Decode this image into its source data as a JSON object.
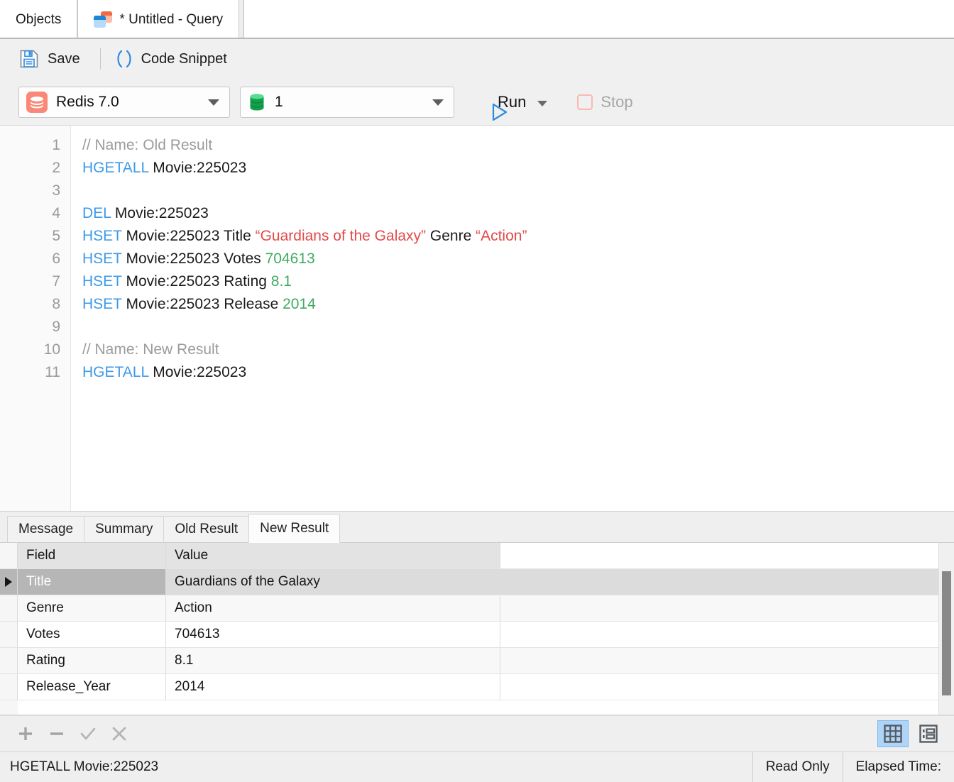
{
  "tabs": {
    "objects": {
      "label": "Objects",
      "icon": "objects-tab"
    },
    "query": {
      "label": "* Untitled - Query",
      "icon": "query-tab-icon"
    }
  },
  "toolbar": {
    "save_label": "Save",
    "save_icon": "floppy-disk-icon",
    "snippet_label": "Code Snippet",
    "snippet_icon": "parentheses-icon"
  },
  "connection": {
    "server_value": "Redis 7.0",
    "server_icon": "redis-logo-icon",
    "database_value": "1",
    "database_icon": "database-cylinder-icon",
    "run_label": "Run",
    "run_icon": "play-triangle-icon",
    "stop_label": "Stop",
    "stop_icon": "stop-square-icon",
    "run_accent": "#2f8ae0",
    "stop_accent": "#fab9b0"
  },
  "editor": {
    "line_numbers": [
      "1",
      "2",
      "3",
      "4",
      "5",
      "6",
      "7",
      "8",
      "9",
      "10",
      "11"
    ],
    "lines": [
      [
        {
          "t": "// Name: Old Result",
          "k": "cmt"
        }
      ],
      [
        {
          "t": "HGETALL",
          "k": "cmd"
        },
        {
          "t": " Movie:225023",
          "k": "plain"
        }
      ],
      [
        {
          "t": "",
          "k": "plain"
        }
      ],
      [
        {
          "t": "DEL",
          "k": "cmd"
        },
        {
          "t": " Movie:225023",
          "k": "plain"
        }
      ],
      [
        {
          "t": "HSET",
          "k": "cmd"
        },
        {
          "t": " Movie:225023 Title ",
          "k": "plain"
        },
        {
          "t": "“Guardians of the Galaxy”",
          "k": "str"
        },
        {
          "t": " Genre ",
          "k": "plain"
        },
        {
          "t": "“Action”",
          "k": "str"
        }
      ],
      [
        {
          "t": "HSET",
          "k": "cmd"
        },
        {
          "t": " Movie:225023 Votes ",
          "k": "plain"
        },
        {
          "t": "704613",
          "k": "num"
        }
      ],
      [
        {
          "t": "HSET",
          "k": "cmd"
        },
        {
          "t": " Movie:225023 Rating ",
          "k": "plain"
        },
        {
          "t": "8.1",
          "k": "num"
        }
      ],
      [
        {
          "t": "HSET",
          "k": "cmd"
        },
        {
          "t": " Movie:225023 Release ",
          "k": "plain"
        },
        {
          "t": "2014",
          "k": "num"
        }
      ],
      [
        {
          "t": "",
          "k": "plain"
        }
      ],
      [
        {
          "t": "// Name: New Result",
          "k": "cmt"
        }
      ],
      [
        {
          "t": "HGETALL",
          "k": "cmd"
        },
        {
          "t": " Movie:225023",
          "k": "plain"
        }
      ]
    ]
  },
  "results": {
    "tabs": [
      {
        "label": "Message",
        "active": false
      },
      {
        "label": "Summary",
        "active": false
      },
      {
        "label": "Old Result",
        "active": false
      },
      {
        "label": "New Result",
        "active": true
      }
    ],
    "columns": [
      "Field",
      "Value"
    ],
    "rows": [
      {
        "field": "Title",
        "value": "Guardians of the Galaxy",
        "selected": true
      },
      {
        "field": "Genre",
        "value": "Action",
        "selected": false
      },
      {
        "field": "Votes",
        "value": "704613",
        "selected": false
      },
      {
        "field": "Rating",
        "value": "8.1",
        "selected": false
      },
      {
        "field": "Release_Year",
        "value": "2014",
        "selected": false
      }
    ]
  },
  "gridbar": {
    "add_icon": "plus-icon",
    "remove_icon": "minus-icon",
    "confirm_icon": "checkmark-icon",
    "cancel_icon": "cross-icon",
    "grid_view_icon": "grid-view-icon",
    "form_view_icon": "form-view-icon",
    "active_view": "grid",
    "selected_highlight": "#aed4f7"
  },
  "statusbar": {
    "query": "HGETALL Movie:225023",
    "mode": "Read Only",
    "elapsed": "Elapsed Time:"
  }
}
